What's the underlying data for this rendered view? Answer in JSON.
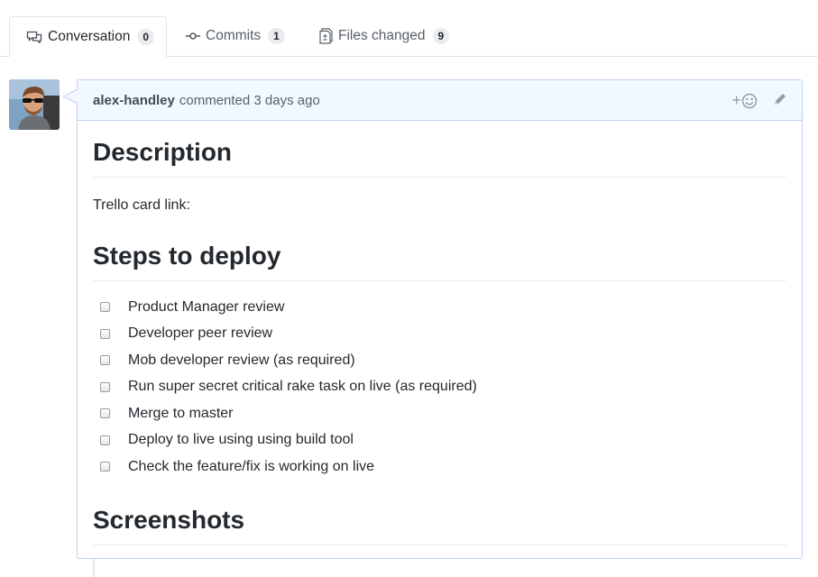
{
  "tabs": [
    {
      "label": "Conversation",
      "count": "0",
      "icon": "comment-discussion-icon"
    },
    {
      "label": "Commits",
      "count": "1",
      "icon": "git-commit-icon"
    },
    {
      "label": "Files changed",
      "count": "9",
      "icon": "file-diff-icon"
    }
  ],
  "comment": {
    "author": "alex-handley",
    "action": "commented 3 days ago",
    "reaction_label": "+",
    "sections": {
      "description": "Description",
      "trello": "Trello card link:",
      "steps": "Steps to deploy",
      "screenshots": "Screenshots"
    },
    "tasks": [
      "Product Manager review",
      "Developer peer review",
      "Mob developer review (as required)",
      "Run super secret critical rake task on live (as required)",
      "Merge to master",
      "Deploy to live using using build tool",
      "Check the feature/fix is working on live"
    ]
  },
  "colors": {
    "header_bg": "#f1f8ff",
    "border": "#c0d3eb",
    "muted": "#586069"
  }
}
